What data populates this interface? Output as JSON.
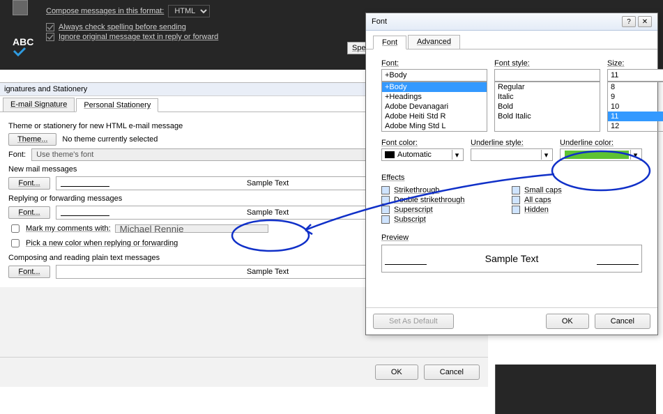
{
  "ribbon": {
    "compose_label": "Compose messages in this format:",
    "compose_value": "HTML",
    "abc": "ABC",
    "check_spelling": "Always check spelling before sending",
    "ignore_original": "Ignore original message text in reply or forward",
    "spell_btn": "Spel"
  },
  "sig_dialog": {
    "title": "ignatures and Stationery",
    "tab1": "E-mail Signature",
    "tab2": "Personal Stationery",
    "theme_header": "Theme or stationery for new HTML e-mail message",
    "theme_btn": "Theme...",
    "no_theme": "No theme currently selected",
    "font_label": "Font:",
    "font_value": "Use theme's font",
    "new_mail": "New mail messages",
    "font_btn": "Font...",
    "sample": "Sample Text",
    "reply_header": "Replying or forwarding messages",
    "mark_label": "Mark my comments with:",
    "mark_value": "Michael Rennie",
    "pick_color": "Pick a new color when replying or forwarding",
    "plain_header": "Composing and reading plain text messages",
    "ok": "OK",
    "cancel": "Cancel"
  },
  "font_dialog": {
    "title": "Font",
    "tab_font": "Font",
    "tab_advanced": "Advanced",
    "font_label": "Font:",
    "font_value": "+Body",
    "font_list": [
      "+Body",
      "+Headings",
      "Adobe Devanagari",
      "Adobe Heiti Std R",
      "Adobe Ming Std L"
    ],
    "style_label": "Font style:",
    "style_list": [
      "Regular",
      "Italic",
      "Bold",
      "Bold Italic"
    ],
    "size_label": "Size:",
    "size_value": "11",
    "size_list": [
      "8",
      "9",
      "10",
      "11",
      "12"
    ],
    "font_color_label": "Font color:",
    "font_color_value": "Automatic",
    "underline_style_label": "Underline style:",
    "underline_color_label": "Underline color:",
    "underline_color": "#5ec232",
    "effects_label": "Effects",
    "eff_left": [
      "Strikethrough",
      "Double strikethrough",
      "Superscript",
      "Subscript"
    ],
    "eff_right": [
      "Small caps",
      "All caps",
      "Hidden"
    ],
    "preview_label": "Preview",
    "preview_text": "Sample Text",
    "set_default": "Set As Default",
    "ok": "OK",
    "cancel": "Cancel"
  }
}
